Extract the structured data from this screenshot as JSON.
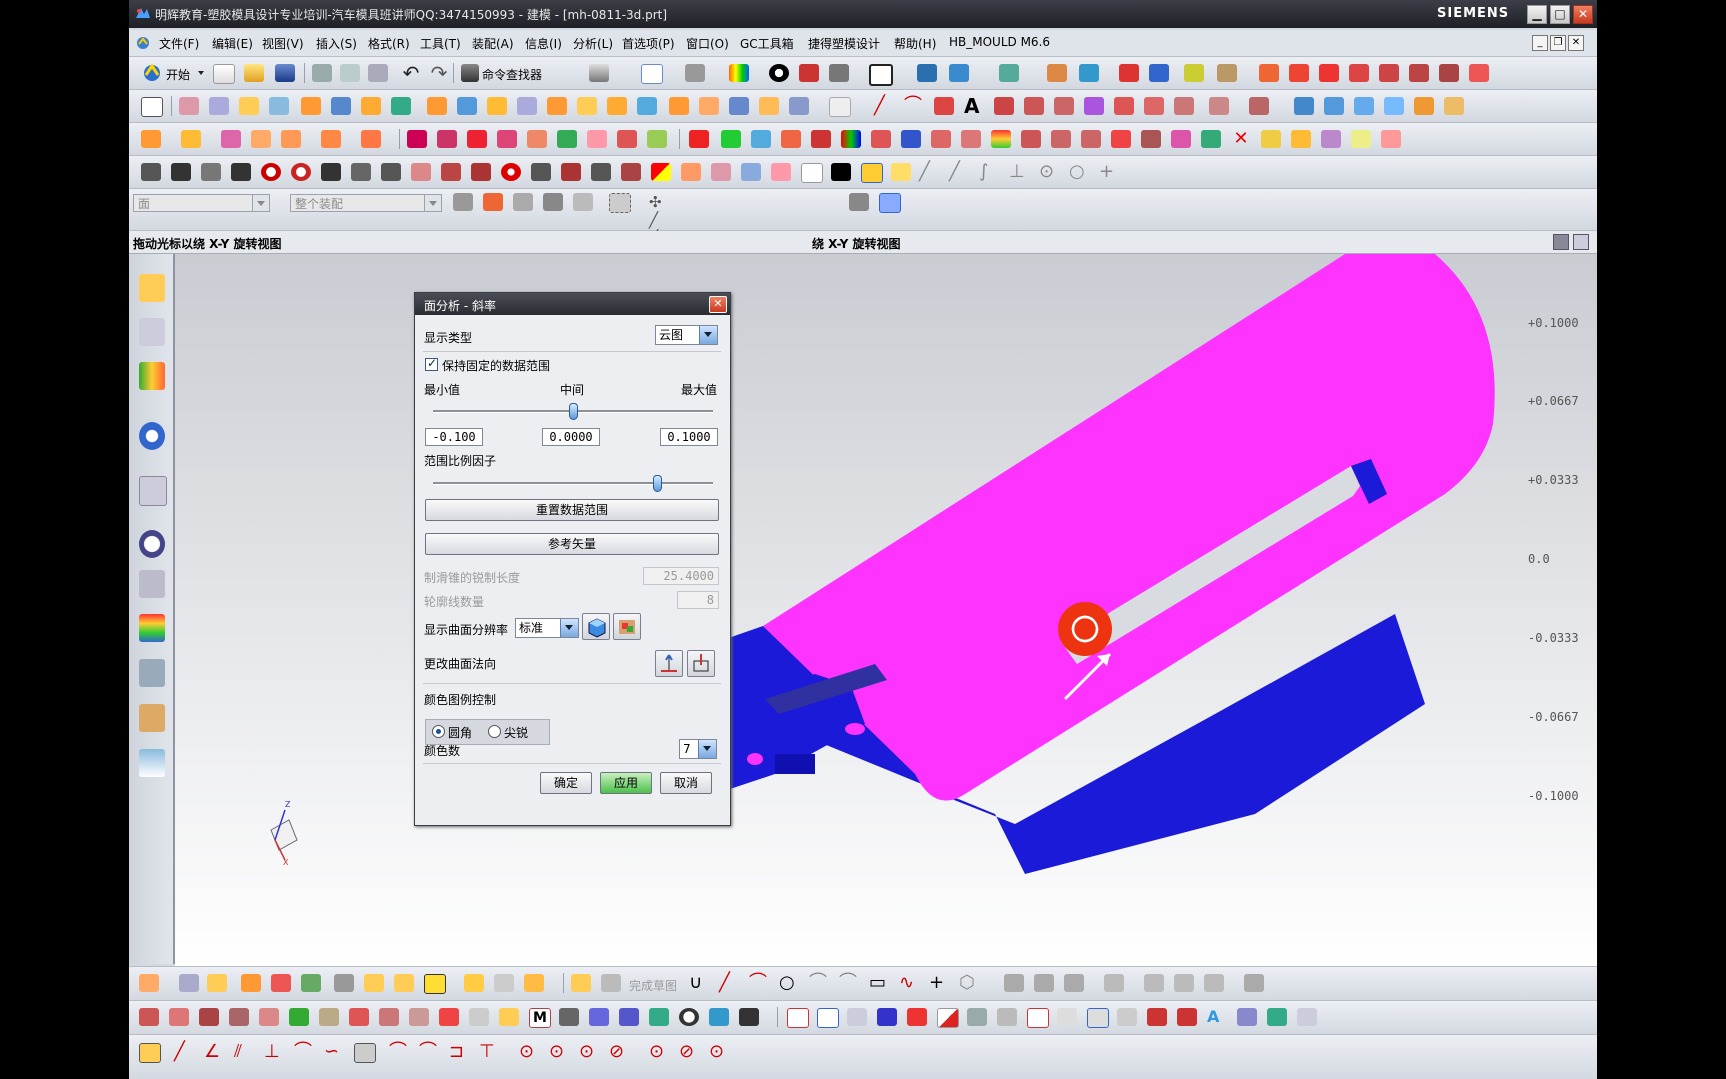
{
  "window": {
    "title": "明辉教育-塑胶模具设计专业培训-汽车模具班讲师QQ:3474150993 - 建模 - [mh-0811-3d.prt]",
    "brand": "SIEMENS",
    "min": "▁",
    "max": "□",
    "close": "✕"
  },
  "menu": {
    "items": [
      "文件(F)",
      "编辑(E)",
      "视图(V)",
      "插入(S)",
      "格式(R)",
      "工具(T)",
      "装配(A)",
      "信息(I)",
      "分析(L)",
      "首选项(P)",
      "窗口(O)",
      "GC工具箱",
      "捷得塑模设计",
      "帮助(H)",
      "HB_MOULD M6.6"
    ]
  },
  "toolbar": {
    "start_label": "开始",
    "command_finder": "命令查找器"
  },
  "selection_bar": {
    "filter": "面",
    "scope": "整个装配"
  },
  "cue": {
    "left": "拖动光标以绕 X-Y 旋转视图",
    "right": "绕 X-Y 旋转视图"
  },
  "dialog": {
    "title": "面分析 - 斜率",
    "close": "✕",
    "display_type_label": "显示类型",
    "display_type_value": "云图",
    "keep_fixed_range": "保持固定的数据范围",
    "keep_fixed_checked": true,
    "min_label": "最小值",
    "mid_label": "中间",
    "max_label": "最大值",
    "min_value": "-0.100",
    "mid_value": "0.0000",
    "max_value": "0.1000",
    "range_scale_label": "范围比例因子",
    "mid_slider": 0.5,
    "scale_slider": 0.8,
    "reset_button": "重置数据范围",
    "ref_vector_button": "参考矢量",
    "draft_length_label": "制滑锥的锐制长度",
    "draft_length_value": "25.4000",
    "contour_count_label": "轮廓线数量",
    "contour_count_value": "8",
    "resolution_label": "显示曲面分辨率",
    "resolution_value": "标准",
    "normal_label": "更改曲面法向",
    "legend_control_label": "颜色图例控制",
    "radio_round": "圆角",
    "radio_sharp": "尖锐",
    "radio_selected": "圆角",
    "color_count_label": "颜色数",
    "color_count_value": "7",
    "ok": "确定",
    "apply": "应用",
    "cancel": "取消"
  },
  "legend": {
    "labels": [
      "+0.1000",
      "+0.0667",
      "+0.0333",
      "0.0",
      "-0.0333",
      "-0.0667",
      "-0.1000"
    ]
  },
  "triad": {
    "z": "Z",
    "x": "X"
  },
  "bottom": {
    "finish_sketch": "完成草图"
  },
  "colors": {
    "model_top": "#ff33ff",
    "model_side": "#1a1ad8",
    "rotate_cursor": "#ee3311"
  }
}
